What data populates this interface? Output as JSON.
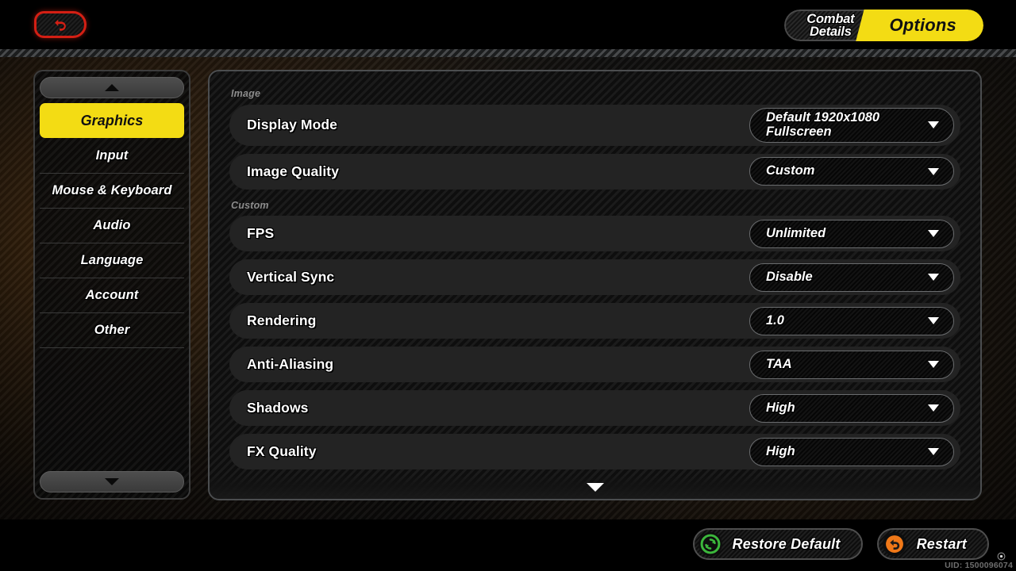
{
  "header": {
    "back_icon": "back-arrow-icon",
    "tab_inactive_line1": "Combat",
    "tab_inactive_line2": "Details",
    "tab_active": "Options"
  },
  "sidebar": {
    "scroll_up_icon": "chevron-up-icon",
    "scroll_down_icon": "chevron-down-icon",
    "items": [
      {
        "label": "Graphics",
        "selected": true
      },
      {
        "label": "Input",
        "selected": false
      },
      {
        "label": "Mouse & Keyboard",
        "selected": false
      },
      {
        "label": "Audio",
        "selected": false
      },
      {
        "label": "Language",
        "selected": false
      },
      {
        "label": "Account",
        "selected": false
      },
      {
        "label": "Other",
        "selected": false
      }
    ]
  },
  "panel": {
    "sections": [
      {
        "label": "Image",
        "rows": [
          {
            "label": "Display Mode",
            "value": "Default 1920x1080 Fullscreen",
            "tall": true
          },
          {
            "label": "Image Quality",
            "value": "Custom",
            "tall": false
          }
        ]
      },
      {
        "label": "Custom",
        "rows": [
          {
            "label": "FPS",
            "value": "Unlimited",
            "tall": false
          },
          {
            "label": "Vertical Sync",
            "value": "Disable",
            "tall": false
          },
          {
            "label": "Rendering",
            "value": "1.0",
            "tall": false
          },
          {
            "label": "Anti-Aliasing",
            "value": "TAA",
            "tall": false
          },
          {
            "label": "Shadows",
            "value": "High",
            "tall": false
          },
          {
            "label": "FX Quality",
            "value": "High",
            "tall": false
          }
        ]
      }
    ],
    "scroll_down_icon": "triangle-down-icon"
  },
  "footer": {
    "restore_default": "Restore Default",
    "restore_default_icon": "refresh-circle-icon",
    "restart": "Restart",
    "restart_icon": "restart-arrow-icon",
    "uid": "UID: 1500096074",
    "uid_icon": "target-icon"
  },
  "colors": {
    "accent_yellow": "#f3dc14",
    "back_red": "#d41f14",
    "restore_green": "#3cb83c",
    "restart_orange": "#f07818",
    "panel_bg": "#131313",
    "row_bg": "#232323"
  }
}
